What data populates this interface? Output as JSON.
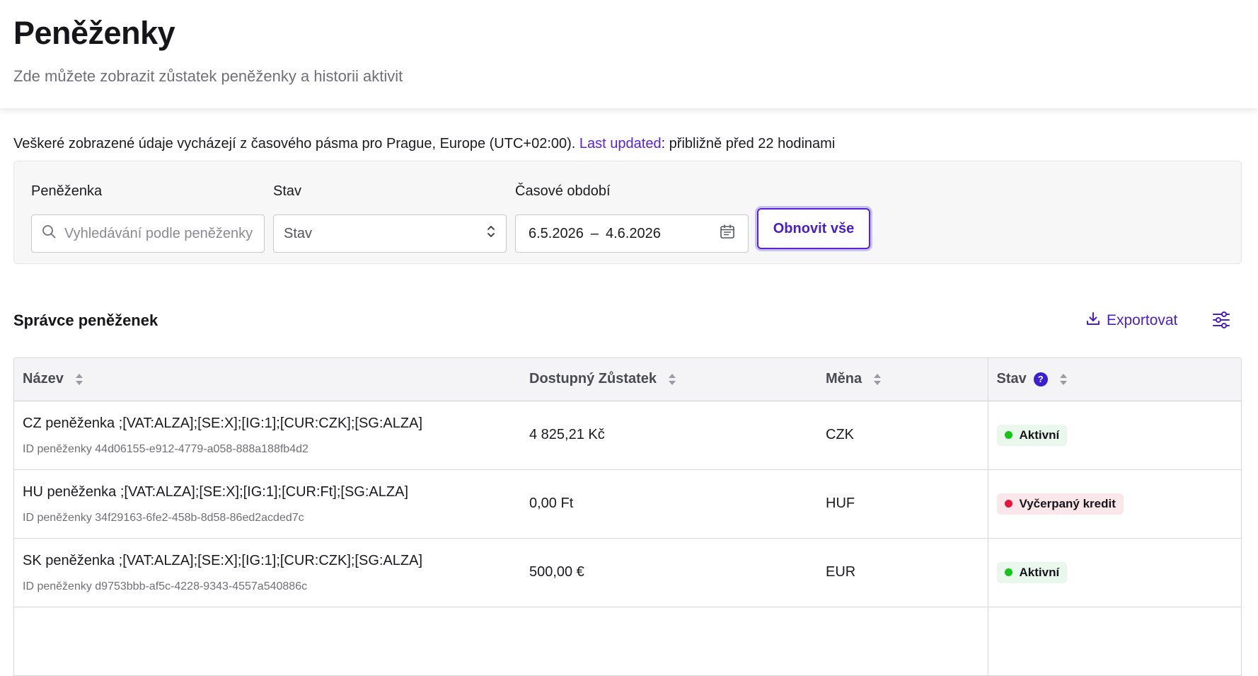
{
  "header": {
    "title": "Peněženky",
    "subtitle": "Zde můžete zobrazit zůstatek peněženky a historii aktivit"
  },
  "timezone_notice": {
    "prefix": "Veškeré zobrazené údaje vycházejí z časového pásma pro Prague, Europe (UTC+02:00). ",
    "link_label": "Last updated",
    "suffix": ": přibližně před 22 hodinami"
  },
  "filters": {
    "wallet": {
      "label": "Peněženka",
      "placeholder": "Vyhledávání podle peněženky"
    },
    "status": {
      "label": "Stav",
      "value": "Stav"
    },
    "period": {
      "label": "Časové období",
      "from": "6.5.2026",
      "separator": "–",
      "to": "4.6.2026"
    },
    "reset_label": "Obnovit vše"
  },
  "section": {
    "title": "Správce peněženek",
    "export_label": "Exportovat"
  },
  "table": {
    "columns": {
      "name": "Název",
      "balance": "Dostupný Zůstatek",
      "currency": "Měna",
      "status": "Stav"
    },
    "id_prefix": "ID peněženky",
    "rows": [
      {
        "name": "CZ peněženka ;[VAT:ALZA];[SE:X];[IG:1];[CUR:CZK];[SG:ALZA]",
        "id": "ID peněženky 44d06155-e912-4779-a058-888a188fb4d2",
        "balance": "4 825,21 Kč",
        "currency": "CZK",
        "status": "Aktivní",
        "status_type": "active"
      },
      {
        "name": "HU peněženka ;[VAT:ALZA];[SE:X];[IG:1];[CUR:Ft];[SG:ALZA]",
        "id": "ID peněženky 34f29163-6fe2-458b-8d58-86ed2acded7c",
        "balance": "0,00 Ft",
        "currency": "HUF",
        "status": "Vyčerpaný kredit",
        "status_type": "depleted"
      },
      {
        "name": "SK peněženka ;[VAT:ALZA];[SE:X];[IG:1];[CUR:CZK];[SG:ALZA]",
        "id": "ID peněženky d9753bbb-af5c-4228-9343-4557a540886c",
        "balance": "500,00 €",
        "currency": "EUR",
        "status": "Aktivní",
        "status_type": "active"
      }
    ]
  },
  "colors": {
    "accent": "#5b21d6",
    "active_dot": "#16c418",
    "depleted_dot": "#e8153a"
  }
}
